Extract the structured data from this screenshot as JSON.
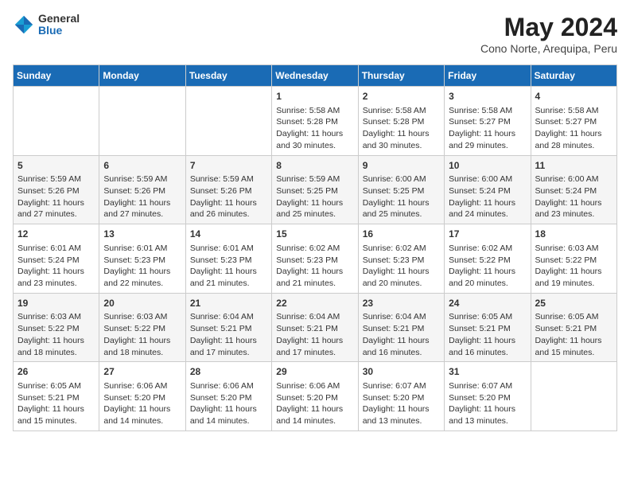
{
  "header": {
    "logo_line1": "General",
    "logo_line2": "Blue",
    "title": "May 2024",
    "subtitle": "Cono Norte, Arequipa, Peru"
  },
  "days_of_week": [
    "Sunday",
    "Monday",
    "Tuesday",
    "Wednesday",
    "Thursday",
    "Friday",
    "Saturday"
  ],
  "weeks": [
    [
      {
        "day": "",
        "info": ""
      },
      {
        "day": "",
        "info": ""
      },
      {
        "day": "",
        "info": ""
      },
      {
        "day": "1",
        "info": "Sunrise: 5:58 AM\nSunset: 5:28 PM\nDaylight: 11 hours\nand 30 minutes."
      },
      {
        "day": "2",
        "info": "Sunrise: 5:58 AM\nSunset: 5:28 PM\nDaylight: 11 hours\nand 30 minutes."
      },
      {
        "day": "3",
        "info": "Sunrise: 5:58 AM\nSunset: 5:27 PM\nDaylight: 11 hours\nand 29 minutes."
      },
      {
        "day": "4",
        "info": "Sunrise: 5:58 AM\nSunset: 5:27 PM\nDaylight: 11 hours\nand 28 minutes."
      }
    ],
    [
      {
        "day": "5",
        "info": "Sunrise: 5:59 AM\nSunset: 5:26 PM\nDaylight: 11 hours\nand 27 minutes."
      },
      {
        "day": "6",
        "info": "Sunrise: 5:59 AM\nSunset: 5:26 PM\nDaylight: 11 hours\nand 27 minutes."
      },
      {
        "day": "7",
        "info": "Sunrise: 5:59 AM\nSunset: 5:26 PM\nDaylight: 11 hours\nand 26 minutes."
      },
      {
        "day": "8",
        "info": "Sunrise: 5:59 AM\nSunset: 5:25 PM\nDaylight: 11 hours\nand 25 minutes."
      },
      {
        "day": "9",
        "info": "Sunrise: 6:00 AM\nSunset: 5:25 PM\nDaylight: 11 hours\nand 25 minutes."
      },
      {
        "day": "10",
        "info": "Sunrise: 6:00 AM\nSunset: 5:24 PM\nDaylight: 11 hours\nand 24 minutes."
      },
      {
        "day": "11",
        "info": "Sunrise: 6:00 AM\nSunset: 5:24 PM\nDaylight: 11 hours\nand 23 minutes."
      }
    ],
    [
      {
        "day": "12",
        "info": "Sunrise: 6:01 AM\nSunset: 5:24 PM\nDaylight: 11 hours\nand 23 minutes."
      },
      {
        "day": "13",
        "info": "Sunrise: 6:01 AM\nSunset: 5:23 PM\nDaylight: 11 hours\nand 22 minutes."
      },
      {
        "day": "14",
        "info": "Sunrise: 6:01 AM\nSunset: 5:23 PM\nDaylight: 11 hours\nand 21 minutes."
      },
      {
        "day": "15",
        "info": "Sunrise: 6:02 AM\nSunset: 5:23 PM\nDaylight: 11 hours\nand 21 minutes."
      },
      {
        "day": "16",
        "info": "Sunrise: 6:02 AM\nSunset: 5:23 PM\nDaylight: 11 hours\nand 20 minutes."
      },
      {
        "day": "17",
        "info": "Sunrise: 6:02 AM\nSunset: 5:22 PM\nDaylight: 11 hours\nand 20 minutes."
      },
      {
        "day": "18",
        "info": "Sunrise: 6:03 AM\nSunset: 5:22 PM\nDaylight: 11 hours\nand 19 minutes."
      }
    ],
    [
      {
        "day": "19",
        "info": "Sunrise: 6:03 AM\nSunset: 5:22 PM\nDaylight: 11 hours\nand 18 minutes."
      },
      {
        "day": "20",
        "info": "Sunrise: 6:03 AM\nSunset: 5:22 PM\nDaylight: 11 hours\nand 18 minutes."
      },
      {
        "day": "21",
        "info": "Sunrise: 6:04 AM\nSunset: 5:21 PM\nDaylight: 11 hours\nand 17 minutes."
      },
      {
        "day": "22",
        "info": "Sunrise: 6:04 AM\nSunset: 5:21 PM\nDaylight: 11 hours\nand 17 minutes."
      },
      {
        "day": "23",
        "info": "Sunrise: 6:04 AM\nSunset: 5:21 PM\nDaylight: 11 hours\nand 16 minutes."
      },
      {
        "day": "24",
        "info": "Sunrise: 6:05 AM\nSunset: 5:21 PM\nDaylight: 11 hours\nand 16 minutes."
      },
      {
        "day": "25",
        "info": "Sunrise: 6:05 AM\nSunset: 5:21 PM\nDaylight: 11 hours\nand 15 minutes."
      }
    ],
    [
      {
        "day": "26",
        "info": "Sunrise: 6:05 AM\nSunset: 5:21 PM\nDaylight: 11 hours\nand 15 minutes."
      },
      {
        "day": "27",
        "info": "Sunrise: 6:06 AM\nSunset: 5:20 PM\nDaylight: 11 hours\nand 14 minutes."
      },
      {
        "day": "28",
        "info": "Sunrise: 6:06 AM\nSunset: 5:20 PM\nDaylight: 11 hours\nand 14 minutes."
      },
      {
        "day": "29",
        "info": "Sunrise: 6:06 AM\nSunset: 5:20 PM\nDaylight: 11 hours\nand 14 minutes."
      },
      {
        "day": "30",
        "info": "Sunrise: 6:07 AM\nSunset: 5:20 PM\nDaylight: 11 hours\nand 13 minutes."
      },
      {
        "day": "31",
        "info": "Sunrise: 6:07 AM\nSunset: 5:20 PM\nDaylight: 11 hours\nand 13 minutes."
      },
      {
        "day": "",
        "info": ""
      }
    ]
  ]
}
